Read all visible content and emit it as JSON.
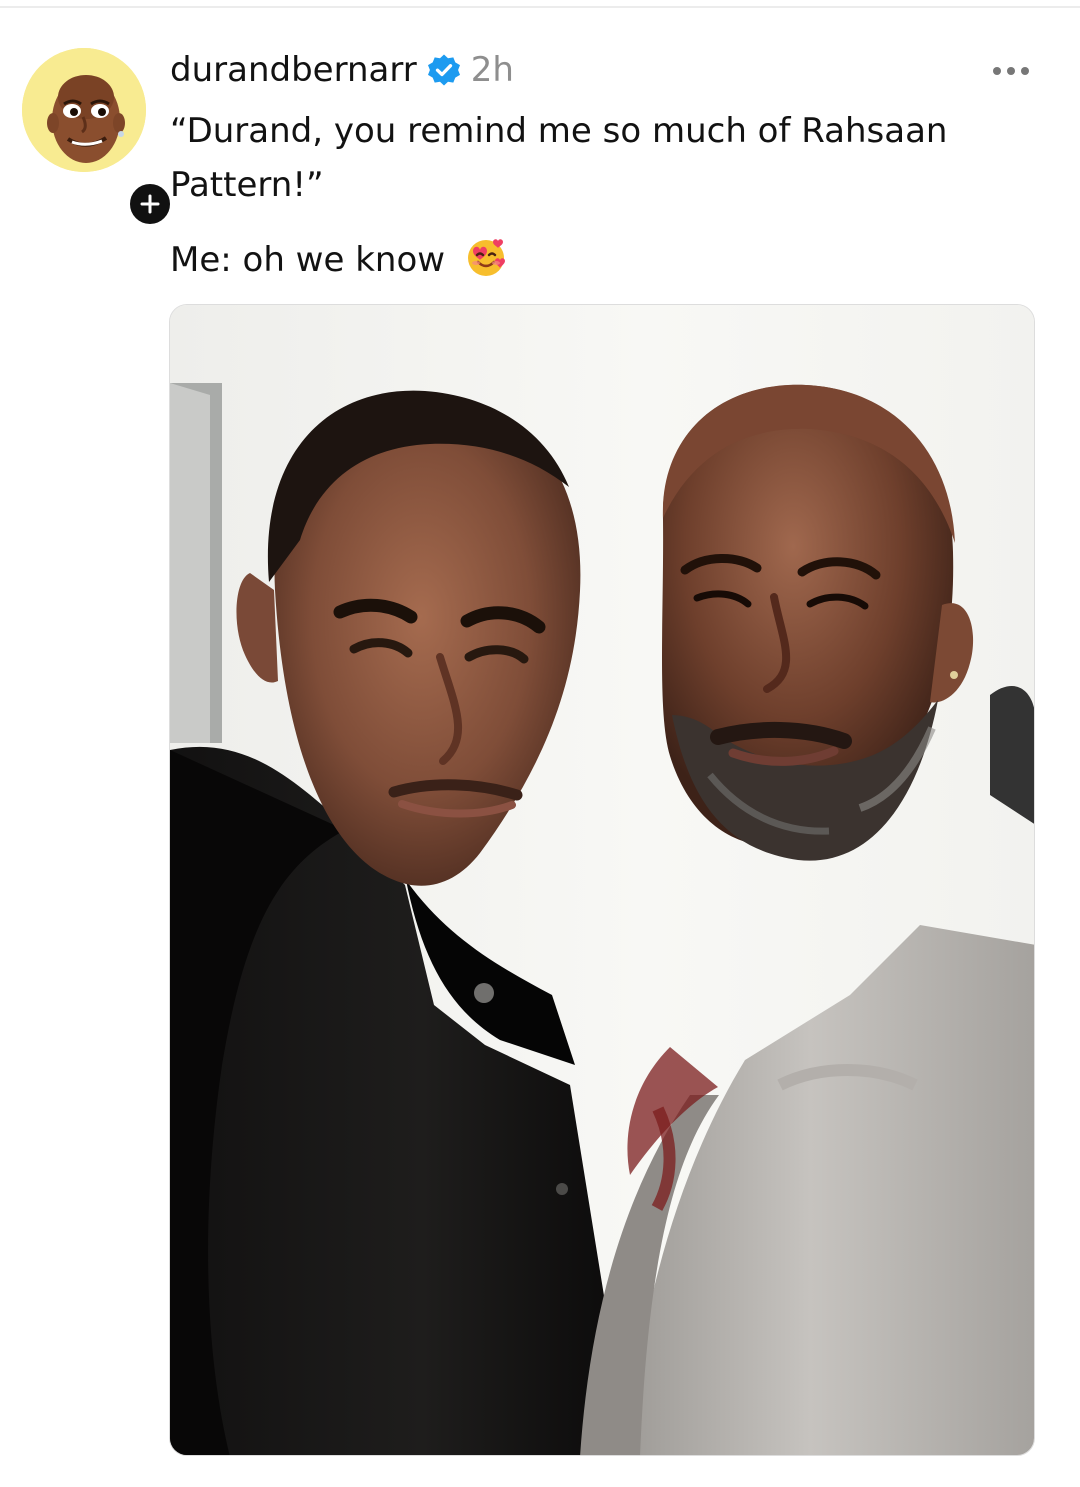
{
  "post": {
    "username": "durandbernarr",
    "time": "2h",
    "caption_lines": [
      "“Durand, you remind me so much of Rahsaan",
      "Pattern!”"
    ],
    "caption_reply": "Me: oh we know",
    "icons": {
      "verified": "verified-badge-icon",
      "emoji": "smiling-face-with-hearts-icon",
      "more": "more-options-icon",
      "follow": "plus-icon"
    },
    "colors": {
      "verified": "#1d9bf0",
      "username": "#121212",
      "time": "#8e8e8e",
      "badge": "#111111"
    }
  }
}
